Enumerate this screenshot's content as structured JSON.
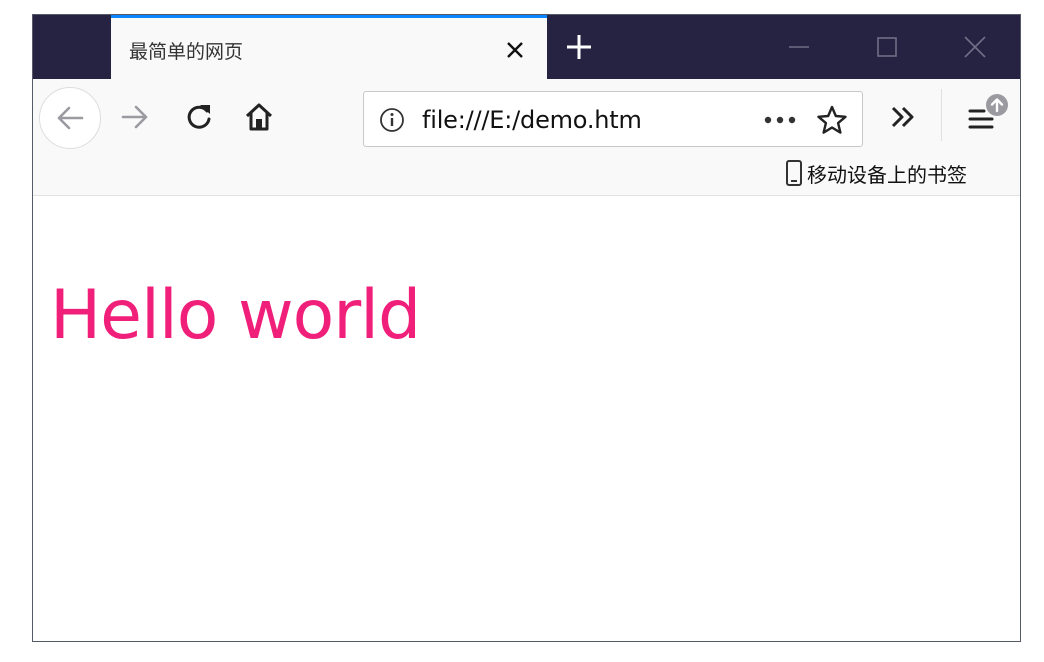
{
  "tab": {
    "title": "最简单的网页"
  },
  "urlbar": {
    "url": "file:///E:/demo.htm",
    "more_label": "•••"
  },
  "bookmarks": {
    "mobile_label": "移动设备上的书签"
  },
  "page": {
    "heading": "Hello world",
    "heading_color": "#f0207a"
  },
  "colors": {
    "titlebar": "#252341",
    "tab_accent": "#0a84ff",
    "toolbar": "#f9f9fa"
  },
  "icons": [
    "close-icon",
    "plus-icon",
    "minimize-icon",
    "maximize-icon",
    "window-close-icon",
    "back-arrow-icon",
    "forward-arrow-icon",
    "reload-icon",
    "home-icon",
    "info-icon",
    "ellipsis-icon",
    "star-icon",
    "chevrons-right-icon",
    "hamburger-menu-icon",
    "update-badge-icon",
    "mobile-device-icon"
  ]
}
